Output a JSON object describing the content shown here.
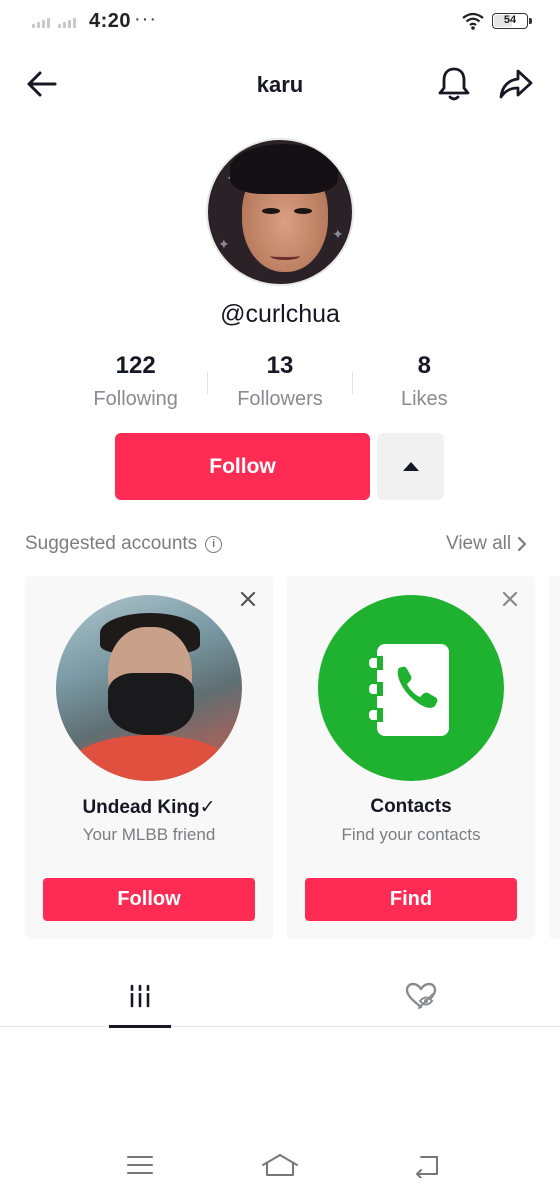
{
  "status_bar": {
    "time": "4:20",
    "more": "···",
    "battery": "54"
  },
  "header": {
    "title": "karu",
    "back_icon": "arrow-left-icon",
    "bell_icon": "bell-icon",
    "share_icon": "share-icon"
  },
  "profile": {
    "username": "@curlchua"
  },
  "stats": [
    {
      "value": "122",
      "label": "Following"
    },
    {
      "value": "13",
      "label": "Followers"
    },
    {
      "value": "8",
      "label": "Likes"
    }
  ],
  "actions": {
    "follow": "Follow"
  },
  "suggested": {
    "title": "Suggested accounts",
    "view_all": "View all",
    "cards": [
      {
        "name": "Undead King✓",
        "subtitle": "Your MLBB friend",
        "button": "Follow"
      },
      {
        "name": "Contacts",
        "subtitle": "Find your contacts",
        "button": "Find"
      }
    ]
  },
  "tabs": {
    "videos_icon": "videos-grid-icon",
    "liked_icon": "liked-hidden-icon"
  },
  "nav": {
    "menu_icon": "menu-icon",
    "home_icon": "home-icon",
    "back_icon": "back-icon"
  },
  "colors": {
    "accent": "#fe2c55",
    "contacts": "#1fb231",
    "muted": "#7c7d83"
  }
}
